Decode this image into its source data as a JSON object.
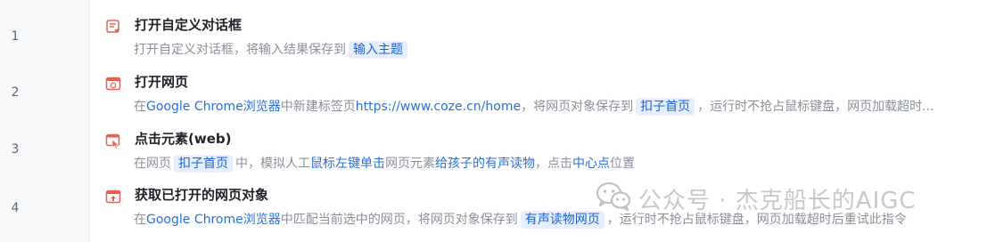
{
  "rows": [
    {
      "number": "1",
      "icon": "dialog-icon",
      "title": "打开自定义对话框",
      "desc": {
        "t1": "打开自定义对话框，将输入结果保存到",
        "chip1": "输入主题"
      }
    },
    {
      "number": "2",
      "icon": "browser-icon",
      "title": "打开网页",
      "desc": {
        "t1": "在",
        "l1": "Google Chrome浏览器",
        "t2": "中新建标签页",
        "l2": "https://www.coze.cn/home",
        "t3": "，将网页对象保存到",
        "chip1": "扣子首页",
        "t4": "，运行时不抢占鼠标键盘，网页加载超时..."
      }
    },
    {
      "number": "3",
      "icon": "click-element-icon",
      "title": "点击元素(web)",
      "desc": {
        "t1": "在网页",
        "chip1": "扣子首页",
        "t2": "中，模拟人工",
        "l1": "鼠标左键单击",
        "t3": "网页元素",
        "l2": "给孩子的有声读物",
        "t4": "，点击",
        "l3": "中心点",
        "t5": "位置"
      }
    },
    {
      "number": "4",
      "icon": "get-webpage-icon",
      "title": "获取已打开的网页对象",
      "desc": {
        "t1": "在",
        "l1": "Google Chrome浏览器",
        "t2": "中匹配当前选中的网页，将网页对象保存到",
        "chip1": "有声读物网页",
        "t3": "，运行时不抢占鼠标键盘，网页加载超时后重试此指令"
      }
    }
  ],
  "watermark": {
    "text": "公众号 · 杰克船长的AIGC",
    "icon": "wechat-icon"
  }
}
